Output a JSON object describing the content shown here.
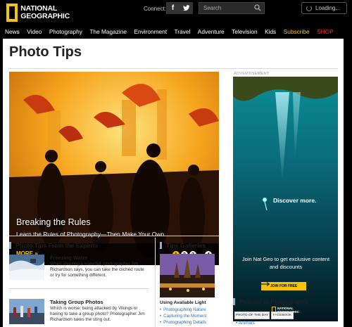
{
  "brand": {
    "line1": "NATIONAL",
    "line2": "GEOGRAPHIC"
  },
  "header": {
    "connect_label": "Connect:",
    "facebook_glyph": "f",
    "search_placeholder": "Search",
    "loading_text": "Loading..."
  },
  "nav": {
    "items": [
      "News",
      "Video",
      "Photography",
      "The Magazine",
      "Environment",
      "Travel",
      "Adventure",
      "Television",
      "Kids"
    ],
    "subscribe": "Subscribe",
    "shop": "SHOP"
  },
  "page": {
    "title": "Photo Tips"
  },
  "hero": {
    "title": "Breaking the Rules",
    "subtitle": "Learn the Rules of Photography—Then Make Your Own",
    "more": "MORE »",
    "slides": [
      "1",
      "2",
      "3",
      "4"
    ]
  },
  "ad": {
    "label": "ADVERTISEMENT",
    "headline": "Discover more.",
    "body": "Join Nat Geo to get exclusive content and discounts",
    "cta": "JOIN FOR FREE",
    "logo_line1": "NATIONAL",
    "logo_line2": "GEOGRAPHIC"
  },
  "tips": {
    "heading": "Photo Tips From the Experts",
    "items": [
      {
        "title": "Freezing Water",
        "desc": "When shooting a waterfall, photographer Jim Richardson says, you can take the clichéd route or try for something different."
      },
      {
        "title": "Taking Group Photos",
        "desc": "Which is worse: being attacked by Vikings or having to take a group photo? Photographer Jim Richardson takes the sting out."
      }
    ]
  },
  "galleries": {
    "heading": "Tips Galleries",
    "caption": "Using Available Light",
    "links": [
      "Photographing Nature",
      "Capturing the Moment",
      "Photographing Details"
    ]
  },
  "popular": {
    "heading": "Popular in Photography",
    "tabs": [
      "PHOTO OF THE DAY",
      "FACEBOOK"
    ],
    "first_link": "Animals"
  },
  "colors": {
    "accent_yellow": "#f6c400",
    "link_blue": "#2a6fb0",
    "shop_red": "#e33333",
    "section_bar": "#7fb6dc"
  }
}
